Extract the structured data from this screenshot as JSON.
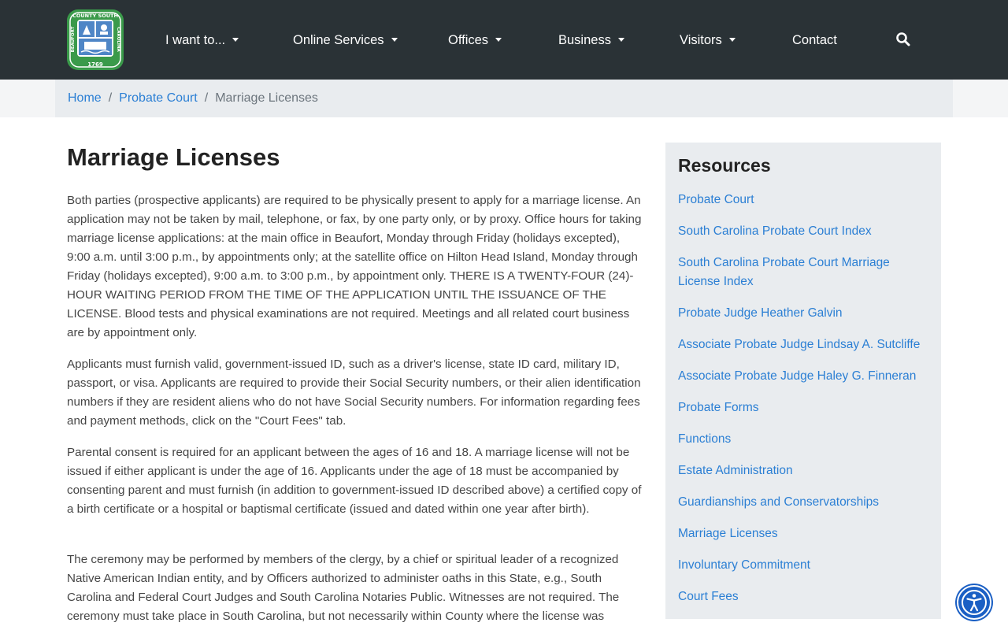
{
  "colors": {
    "nav_bg": "#2a3236",
    "link": "#2b7fd4",
    "breadcrumb_bg": "#e9ecef",
    "sidebar_bg": "#e9ecef",
    "accessibility_button": "#1a5fc4",
    "logo_green": "#3a9a4a"
  },
  "logo": {
    "top_text": "COUNTY SOUTH",
    "left_text": "BEAUFORT",
    "right_text": "CAROLINA",
    "year": "1769"
  },
  "nav": {
    "items": [
      {
        "label": "I want to...",
        "dropdown": true
      },
      {
        "label": "Online Services",
        "dropdown": true
      },
      {
        "label": "Offices",
        "dropdown": true
      },
      {
        "label": "Business",
        "dropdown": true
      },
      {
        "label": "Visitors",
        "dropdown": true
      },
      {
        "label": "Contact",
        "dropdown": false
      }
    ],
    "search_icon": "search-icon"
  },
  "breadcrumb": {
    "home": "Home",
    "parent": "Probate Court",
    "current": "Marriage Licenses",
    "separator": "/"
  },
  "main": {
    "title": "Marriage Licenses",
    "paragraphs": [
      "Both parties (prospective applicants) are required to be physically present to apply for a marriage license. An application may not be taken by mail, telephone, or fax, by one party only, or by proxy. Office hours for taking marriage license applications: at the main office in Beaufort, Monday through Friday (holidays excepted), 9:00 a.m. until 3:00 p.m., by appointments only; at the satellite office on Hilton Head Island, Monday through Friday (holidays excepted), 9:00 a.m. to 3:00 p.m., by appointment only. THERE IS A TWENTY-FOUR (24)-HOUR WAITING PERIOD FROM THE TIME OF THE APPLICATION UNTIL THE ISSUANCE OF THE LICENSE. Blood tests and physical examinations are not required. Meetings and all related court business are by appointment only.",
      "Applicants must furnish valid, government-issued ID, such as a driver's license, state ID card, military ID, passport, or visa. Applicants are required to provide their Social Security numbers, or their alien identification numbers if they are resident aliens who do not have Social Security numbers. For information regarding fees and payment methods, click on the \"Court Fees\" tab.",
      "Parental consent is required for an applicant between the ages of 16 and 18. A marriage license will not be issued if either applicant is under the age of 16. Applicants under the age of 18 must be accompanied by consenting parent and must furnish (in addition to government-issued ID described above) a certified copy of a birth certificate or a hospital or baptismal certificate (issued and dated within one year after birth).",
      "The ceremony may be performed by members of the clergy, by a chief or spiritual leader of a recognized Native American Indian entity, and by Officers authorized to administer oaths in this State, e.g., South Carolina and Federal Court Judges and South Carolina Notaries Public. Witnesses are not required. The ceremony must take place in South Carolina, but not necessarily within County where the license was"
    ]
  },
  "sidebar": {
    "title": "Resources",
    "links": [
      "Probate Court",
      "South Carolina Probate Court Index",
      "South Carolina Probate Court Marriage License Index",
      "Probate Judge Heather Galvin",
      "Associate Probate Judge Lindsay A. Sutcliffe",
      "Associate Probate Judge Haley G. Finneran",
      "Probate Forms",
      "Functions",
      "Estate Administration",
      "Guardianships and Conservatorships",
      "Marriage Licenses",
      "Involuntary Commitment",
      "Court Fees"
    ]
  },
  "accessibility": {
    "icon": "accessibility-icon"
  }
}
